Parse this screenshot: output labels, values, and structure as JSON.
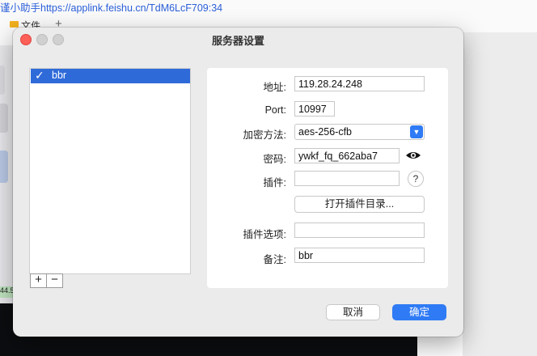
{
  "background": {
    "url_text": "谨小助手https://applink.feishu.cn/TdM6LcF709:34",
    "folder_tab": "文件",
    "new_tab": "+",
    "side_tag": "44.5"
  },
  "dialog": {
    "title": "服务器设置",
    "server_list": {
      "items": [
        {
          "name": "bbr",
          "checked": true,
          "check_mark": "✓"
        }
      ],
      "add_label": "+",
      "remove_label": "−"
    },
    "form": {
      "address": {
        "label": "地址:",
        "value": "119.28.24.248"
      },
      "port": {
        "label": "Port:",
        "value": "10997"
      },
      "encryption": {
        "label": "加密方法:",
        "value": "aes-256-cfb"
      },
      "password": {
        "label": "密码:",
        "value": "ywkf_fq_662aba7"
      },
      "plugin": {
        "label": "插件:",
        "value": "",
        "help_label": "?"
      },
      "open_plugin_dir": "打开插件目录...",
      "plugin_options": {
        "label": "插件选项:",
        "value": ""
      },
      "remark": {
        "label": "备注:",
        "value": "bbr"
      }
    },
    "buttons": {
      "cancel": "取消",
      "ok": "确定"
    },
    "colors": {
      "accent": "#2f7bf5",
      "selection": "#2f6ad9",
      "close": "#fe5f57"
    }
  }
}
